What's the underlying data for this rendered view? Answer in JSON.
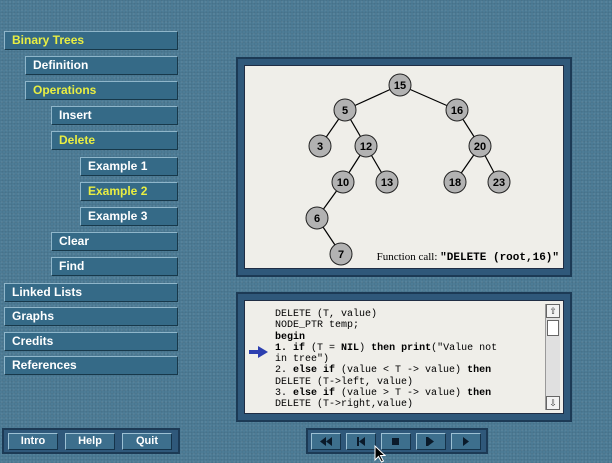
{
  "nav": {
    "binary_trees": "Binary Trees",
    "definition": "Definition",
    "operations": "Operations",
    "insert": "Insert",
    "delete": "Delete",
    "example1": "Example 1",
    "example2": "Example 2",
    "example3": "Example 3",
    "clear": "Clear",
    "find": "Find",
    "linked_lists": "Linked Lists",
    "graphs": "Graphs",
    "credits": "Credits",
    "references": "References"
  },
  "footer": {
    "intro": "Intro",
    "help": "Help",
    "quit": "Quit"
  },
  "tree": {
    "nodes": [
      "15",
      "5",
      "16",
      "3",
      "12",
      "20",
      "10",
      "13",
      "18",
      "23",
      "6",
      "7"
    ],
    "caption_prefix": "Function call: ",
    "caption_call": "\"DELETE (root,16)\""
  },
  "code": {
    "line1": "DELETE (T, value)",
    "line2": "NODE_PTR temp;",
    "line3": "begin",
    "line4a": "1. ",
    "line4b": "if",
    "line4c": " (T = ",
    "line4d": "NIL",
    "line4e": ") ",
    "line4f": "then print",
    "line4g": "(\"Value not",
    "line5": "in tree\")",
    "line6a": "2. ",
    "line6b": "else if",
    "line6c": " (value < T -> value) ",
    "line6d": "then",
    "line7": "DELETE (T->left, value)",
    "line8a": "3. ",
    "line8b": "else if",
    "line8c": " (value > T -> value) ",
    "line8d": "then",
    "line9": "DELETE (T->right,value)"
  },
  "colors": {
    "active_text": "#e9ee42",
    "node_fill": "#b2b2b2",
    "arrow": "#2c3fb0"
  }
}
